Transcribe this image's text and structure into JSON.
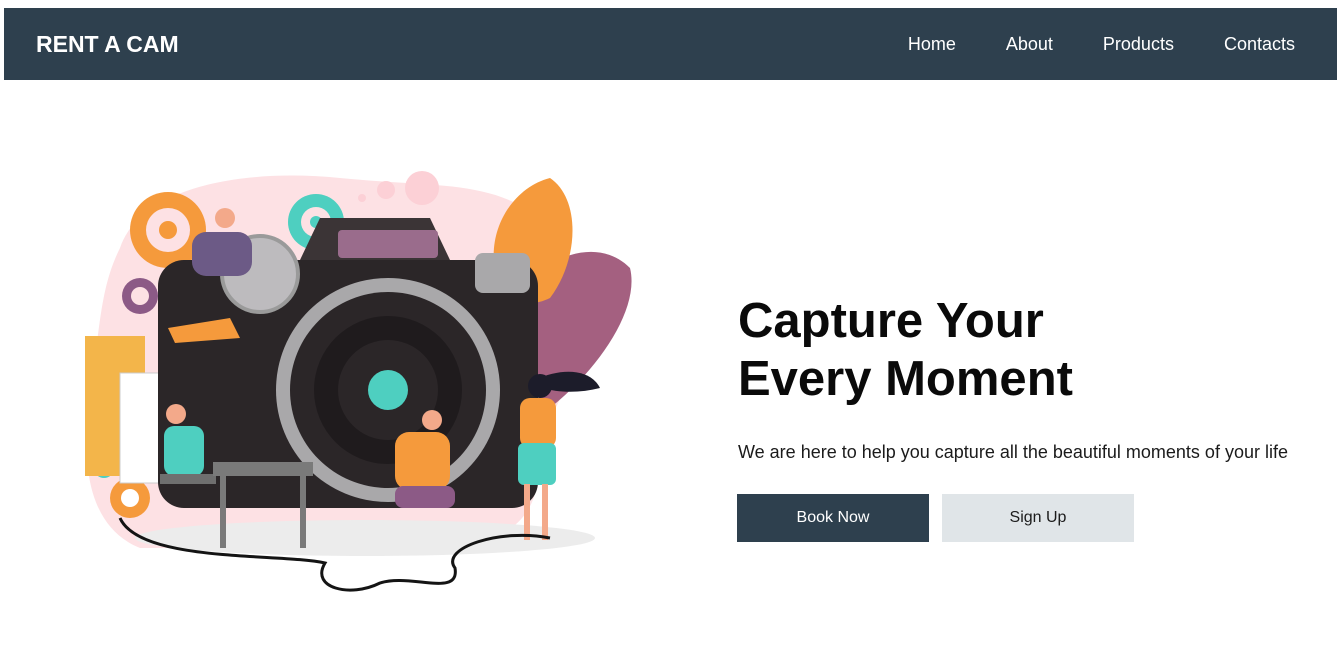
{
  "header": {
    "brand": "RENT A CAM",
    "nav": [
      {
        "label": "Home"
      },
      {
        "label": "About"
      },
      {
        "label": "Products"
      },
      {
        "label": "Contacts"
      }
    ]
  },
  "hero": {
    "title_line1": "Capture Your",
    "title_line2": "Every Moment",
    "subtitle": "We are here to help you capture all the beautiful moments of your life",
    "primary_button": "Book Now",
    "secondary_button": "Sign Up",
    "illustration": "camera-photographers-illustration"
  },
  "colors": {
    "navbar_bg": "#2e404e",
    "secondary_button_bg": "#e0e5e8",
    "accent_orange": "#f7913a",
    "accent_teal": "#4ecfc0",
    "accent_pink": "#fcd3d8",
    "accent_purple": "#9b5c8a"
  }
}
